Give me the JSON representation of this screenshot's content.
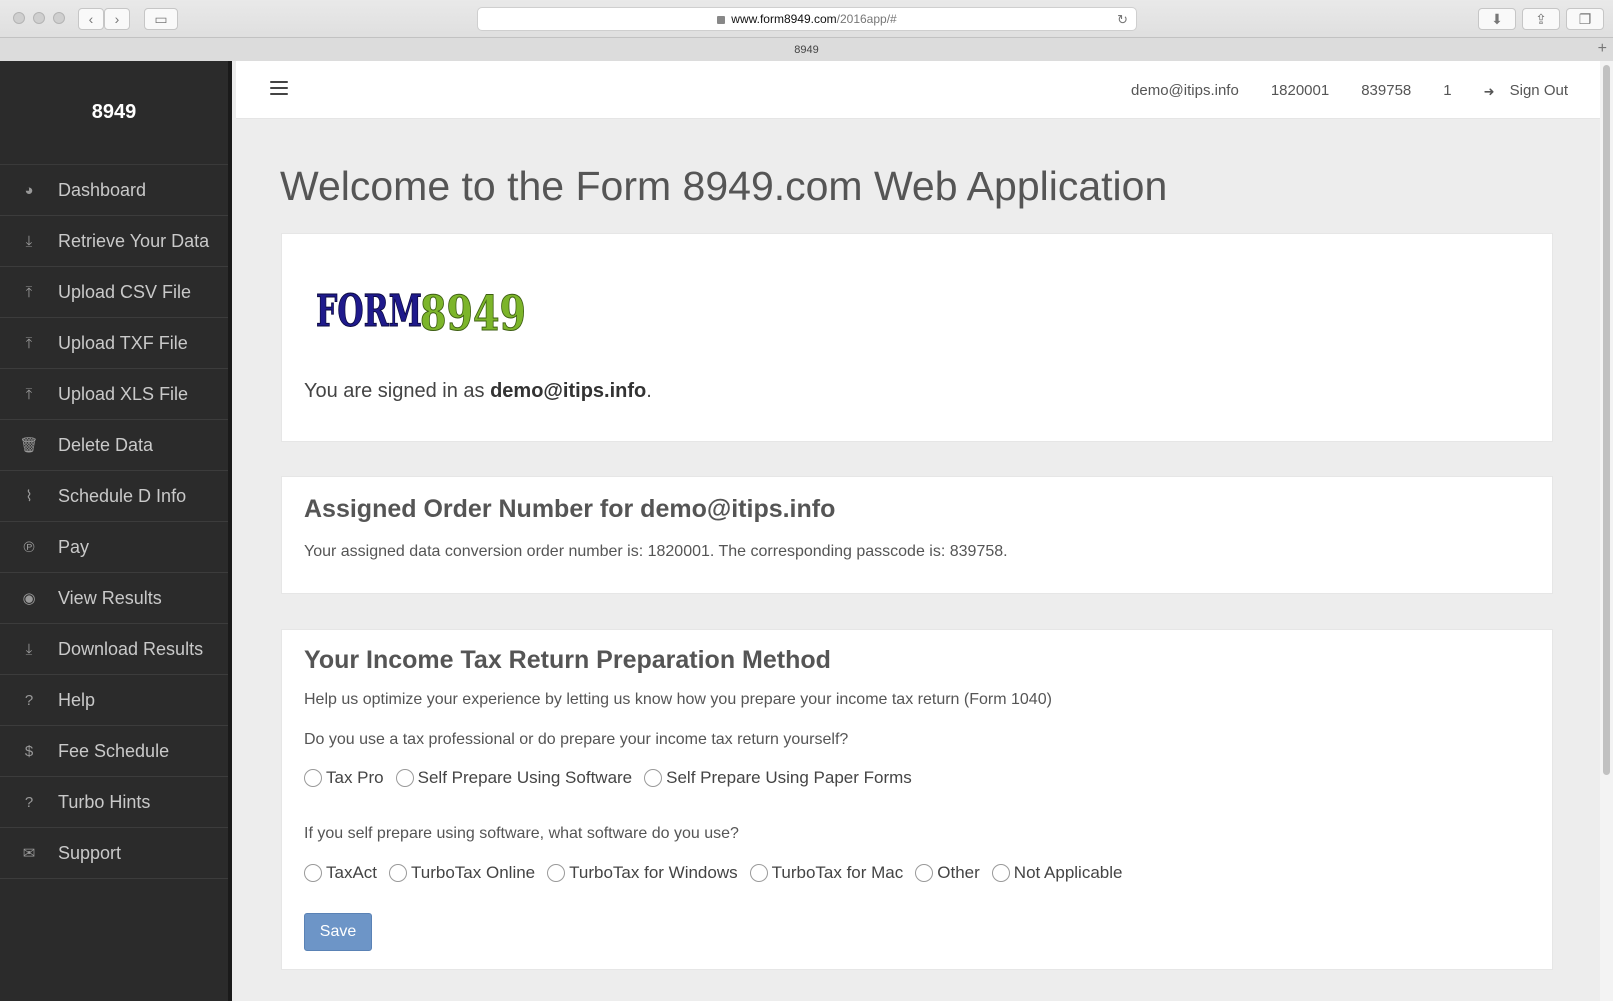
{
  "browser": {
    "url_host": "www.form8949.com",
    "url_path": "/2016app/#",
    "tab_title": "8949"
  },
  "sidebar": {
    "brand": "8949",
    "items": [
      {
        "label": "Dashboard",
        "icon": "dashboard-icon"
      },
      {
        "label": "Retrieve Your Data",
        "icon": "download-icon"
      },
      {
        "label": "Upload CSV File",
        "icon": "upload-icon"
      },
      {
        "label": "Upload TXF File",
        "icon": "upload-icon"
      },
      {
        "label": "Upload XLS File",
        "icon": "upload-icon"
      },
      {
        "label": "Delete Data",
        "icon": "trash-icon"
      },
      {
        "label": "Schedule D Info",
        "icon": "paperclip-icon"
      },
      {
        "label": "Pay",
        "icon": "paypal-icon"
      },
      {
        "label": "View Results",
        "icon": "eye-icon"
      },
      {
        "label": "Download Results",
        "icon": "download-icon"
      },
      {
        "label": "Help",
        "icon": "question-icon"
      },
      {
        "label": "Fee Schedule",
        "icon": "dollar-icon"
      },
      {
        "label": "Turbo Hints",
        "icon": "question-icon"
      },
      {
        "label": "Support",
        "icon": "envelope-icon"
      }
    ]
  },
  "topbar": {
    "email": "demo@itips.info",
    "order_number": "1820001",
    "passcode": "839758",
    "count": "1",
    "signout": "Sign Out"
  },
  "page": {
    "title": "Welcome to the Form 8949.com Web Application",
    "logo_text_1": "FORM",
    "logo_text_2": "8949",
    "signed_prefix": "You are signed in as ",
    "signed_email": "demo@itips.info",
    "signed_suffix": "."
  },
  "order_panel": {
    "title": "Assigned Order Number for demo@itips.info",
    "text": "Your assigned data conversion order number is: 1820001. The corresponding passcode is: 839758."
  },
  "method_panel": {
    "title": "Your Income Tax Return Preparation Method",
    "intro": "Help us optimize your experience by letting us know how you prepare your income tax return (Form 1040)",
    "q1": "Do you use a tax professional or do prepare your income tax return yourself?",
    "q1_options": [
      "Tax Pro",
      "Self Prepare Using Software",
      "Self Prepare Using Paper Forms"
    ],
    "q2": "If you self prepare using software, what software do you use?",
    "q2_options": [
      "TaxAct",
      "TurboTax Online",
      "TurboTax for Windows",
      "TurboTax for Mac",
      "Other",
      "Not Applicable"
    ],
    "save_label": "Save"
  },
  "colors": {
    "sidebar_bg": "#2b2b2b",
    "save_button": "#6d95c7",
    "logo_blue": "#1f1a8c",
    "logo_green": "#7cb52a"
  }
}
